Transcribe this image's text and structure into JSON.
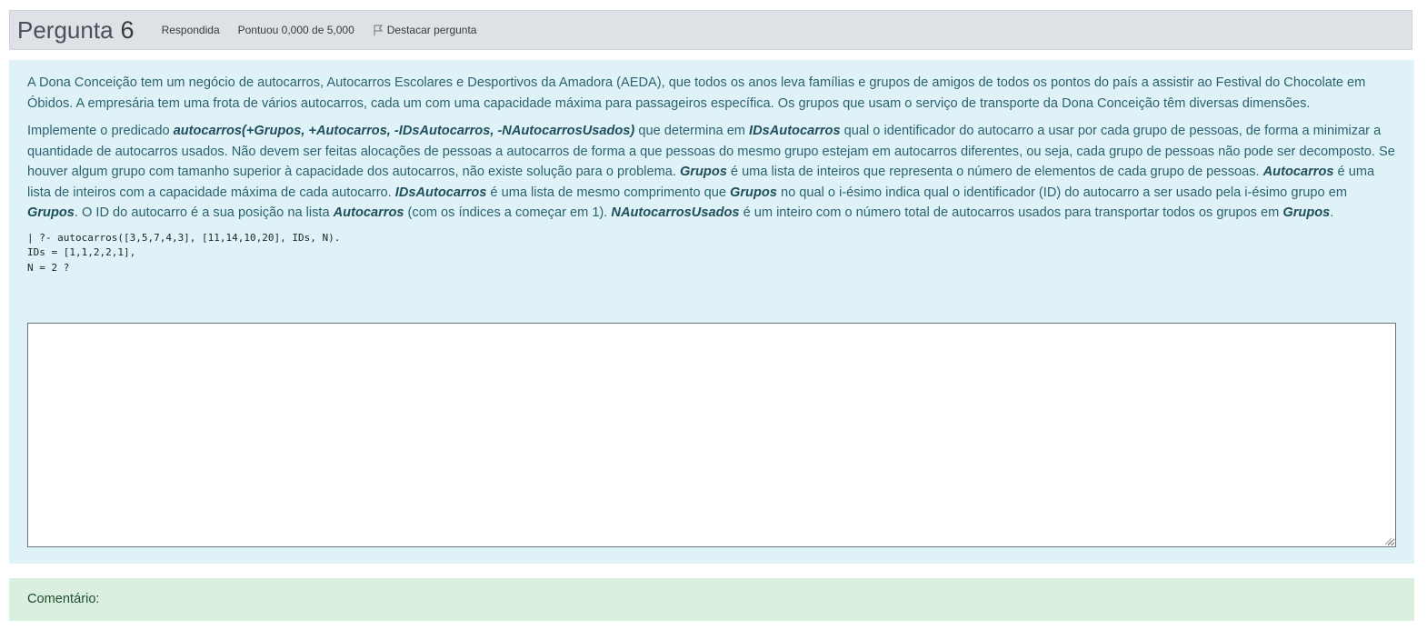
{
  "header": {
    "title_word": "Pergunta",
    "question_number": "6",
    "status": "Respondida",
    "score": "Pontuou 0,000 de 5,000",
    "flag_label": "Destacar pergunta",
    "flag_icon": "flag-icon"
  },
  "question": {
    "paragraph1": "A Dona Conceição tem um negócio de autocarros, Autocarros Escolares e Desportivos da Amadora (AEDA), que todos os anos leva famílias e grupos de amigos de todos os pontos do país a assistir ao Festival do Chocolate em Óbidos. A empresária tem uma frota de vários autocarros, cada um com uma capacidade máxima para passageiros específica. Os grupos que usam o serviço de transporte da Dona Conceição têm diversas dimensões.",
    "p2": {
      "t1": "Implemente o predicado ",
      "b1": "autocarros(+Grupos, +Autocarros, -IDsAutocarros, -NAutocarrosUsados)",
      "t2": " que determina em ",
      "b2": "IDsAutocarros",
      "t3": " qual o identificador do autocarro a usar por cada grupo de pessoas, de forma a minimizar a quantidade de autocarros usados. Não devem ser feitas alocações de pessoas a autocarros de forma a que pessoas do mesmo grupo estejam em autocarros diferentes, ou seja, cada grupo de pessoas não pode ser decomposto. Se houver algum grupo com tamanho superior à capacidade dos autocarros, não existe solução para o problema. ",
      "b3": "Grupos",
      "t4": " é uma lista de inteiros que representa o número de elementos de cada grupo de pessoas. ",
      "b4": "Autocarros",
      "t5": " é uma lista de inteiros com a capacidade máxima de cada autocarro. ",
      "b5": "IDsAutocarros",
      "t6": " é uma lista de mesmo comprimento que ",
      "b6": "Grupos",
      "t7": " no qual o i-ésimo indica qual o identificador (ID) do autocarro a ser usado pela i-ésimo grupo em ",
      "b7": "Grupos",
      "t8": ". O ID do autocarro é a sua posição na lista ",
      "b8": "Autocarros",
      "t9": " (com os índices a começar em 1). ",
      "b9": "NAutocarrosUsados",
      "t10": " é um inteiro com o número total de autocarros usados para transportar todos os grupos em ",
      "b10": "Grupos",
      "t11": "."
    },
    "code_lines": [
      "| ?- autocarros([3,5,7,4,3], [11,14,10,20], IDs, N).",
      "IDs = [1,1,2,2,1],",
      "N = 2 ?"
    ]
  },
  "answer": {
    "value": ""
  },
  "comment": {
    "label": "Comentário:"
  }
}
